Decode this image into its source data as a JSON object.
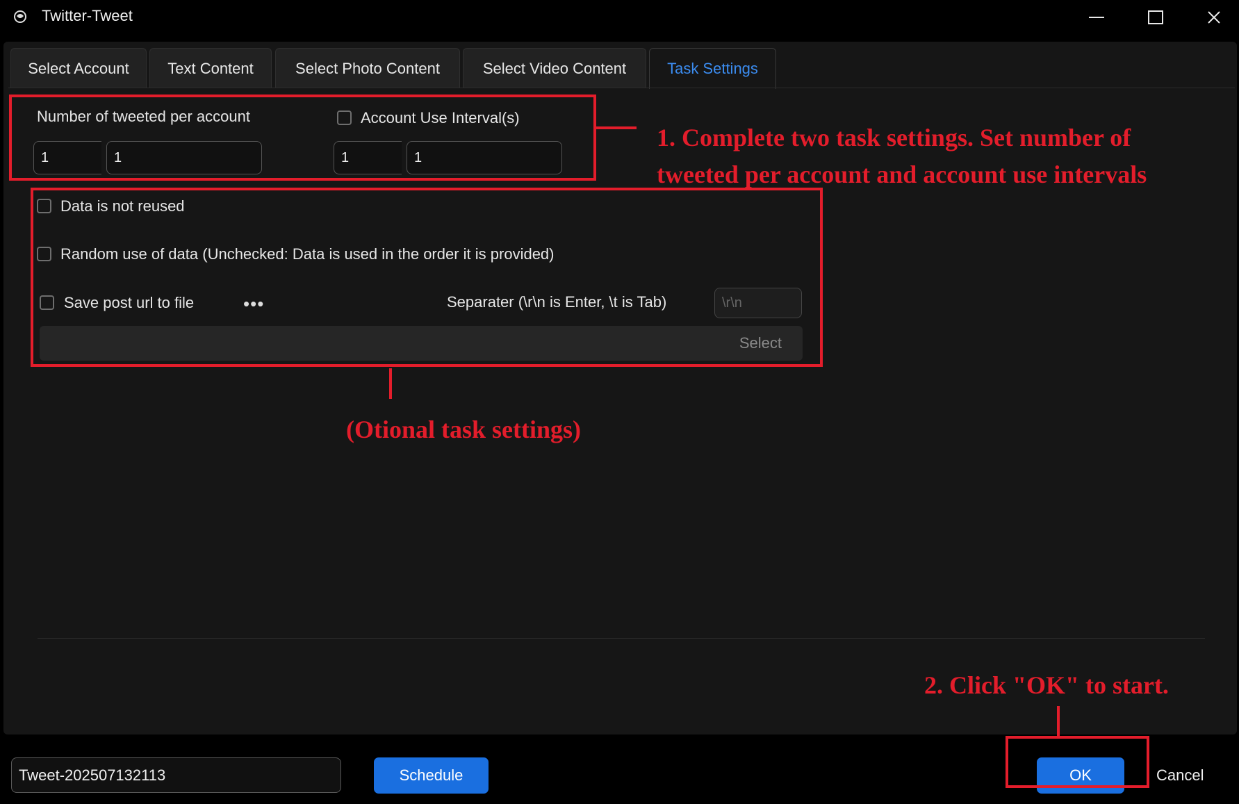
{
  "window": {
    "title": "Twitter-Tweet",
    "icon": "app-logo-icon",
    "controls": [
      "minimize-icon",
      "maximize-icon",
      "close-icon"
    ]
  },
  "tabs": [
    {
      "label": "Select Account",
      "active": false
    },
    {
      "label": "Text Content",
      "active": false
    },
    {
      "label": "Select Photo Content",
      "active": false
    },
    {
      "label": "Select Video Content",
      "active": false
    },
    {
      "label": "Task Settings",
      "active": true
    }
  ],
  "settings": {
    "tweets_per_account_label": "Number of tweeted per account",
    "tweets_min": "1",
    "tweets_max": "1",
    "interval_label": "Account Use Interval(s)",
    "interval_checked": false,
    "interval_min": "1",
    "interval_max": "1",
    "data_not_reused_label": "Data is not reused",
    "data_not_reused_checked": false,
    "random_use_label": "Random use of data (Unchecked: Data is used in the order it is provided)",
    "random_use_checked": false,
    "save_url_label": "Save post url to file",
    "save_url_checked": false,
    "more_label": "•••",
    "separator_label": "Separater (\\r\\n is Enter, \\t is Tab)",
    "separator_placeholder": "\\r\\n",
    "select_label": "Select"
  },
  "footer": {
    "task_name": "Tweet-202507132113",
    "schedule_label": "Schedule",
    "ok_label": "OK",
    "cancel_label": "Cancel"
  },
  "annotations": {
    "step1_line1": "1. Complete two task settings. Set number of",
    "step1_line2": "tweeted per account and account use intervals",
    "optional": "(Otional task settings)",
    "step2": "2. Click \"OK\" to start.",
    "color": "#e31d2b"
  },
  "colors": {
    "accent": "#1a6fe0",
    "active_tab_text": "#3b8cf0",
    "background": "#161616"
  }
}
